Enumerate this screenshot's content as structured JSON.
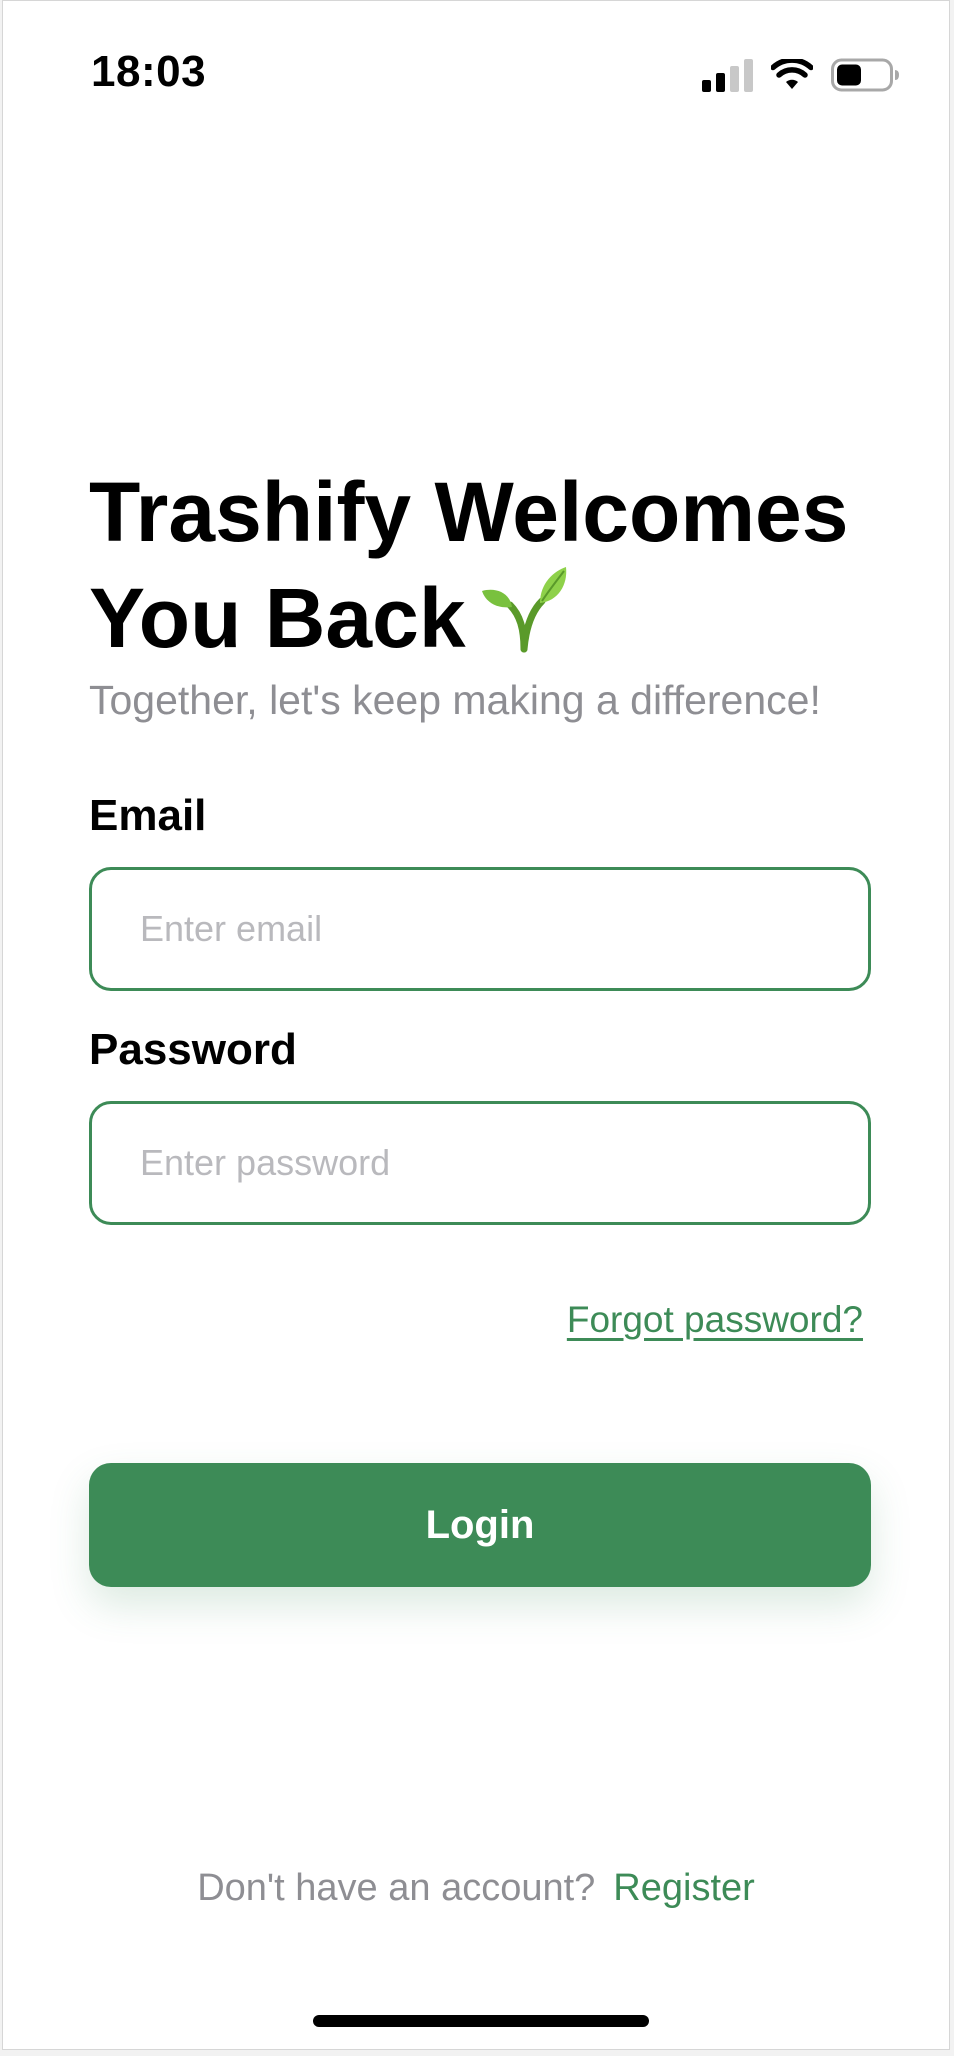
{
  "status_bar": {
    "time": "18:03"
  },
  "header": {
    "title_line1": "Trashify Welcomes",
    "title_line2": "You Back",
    "title_icon": "seedling-icon",
    "subtitle": "Together, let's keep making a difference!"
  },
  "form": {
    "email_label": "Email",
    "email_placeholder": "Enter email",
    "email_value": "",
    "password_label": "Password",
    "password_placeholder": "Enter password",
    "password_value": "",
    "forgot_password": "Forgot password?",
    "login_label": "Login"
  },
  "footer": {
    "prompt": "Don't have an account?",
    "register_link": "Register"
  },
  "colors": {
    "accent": "#3d8b57",
    "muted_text": "#8e8e93",
    "placeholder": "#b9b9bd"
  }
}
